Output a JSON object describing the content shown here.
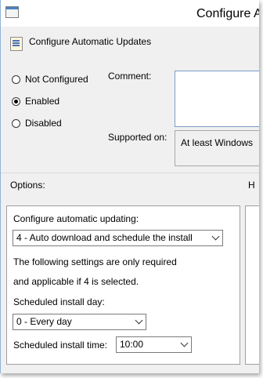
{
  "window": {
    "title": "Configure A"
  },
  "policy": {
    "name": "Configure Automatic Updates"
  },
  "state": {
    "options": [
      {
        "label": "Not Configured",
        "checked": false
      },
      {
        "label": "Enabled",
        "checked": true
      },
      {
        "label": "Disabled",
        "checked": false
      }
    ]
  },
  "comment": {
    "label": "Comment:",
    "value": ""
  },
  "supported": {
    "label": "Supported on:",
    "value": "At least Windows"
  },
  "options_section": {
    "label": "Options:",
    "help_label": "H"
  },
  "configure": {
    "label": "Configure automatic updating:",
    "selected": "4 - Auto download and schedule the install",
    "note_line1": "The following settings are only required",
    "note_line2": "and applicable if 4 is selected.",
    "day_label": "Scheduled install day:",
    "day_selected": "0 - Every day",
    "time_label": "Scheduled install time:",
    "time_selected": "10:00"
  }
}
